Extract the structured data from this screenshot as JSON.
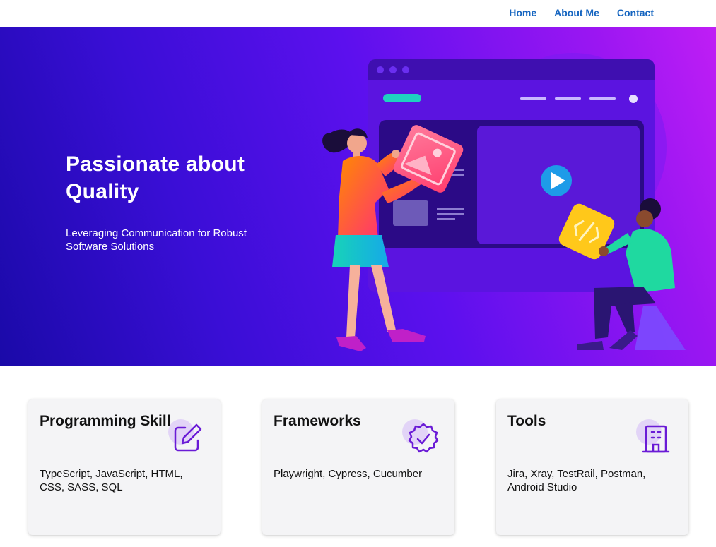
{
  "nav": {
    "links": [
      {
        "label": "Home"
      },
      {
        "label": "About Me"
      },
      {
        "label": "Contact"
      }
    ]
  },
  "hero": {
    "title": "Passionate about Quality",
    "subtitle": "Leveraging Communication for Robust Software Solutions"
  },
  "cards": [
    {
      "title": "Programming Skill",
      "body": "TypeScript, JavaScript, HTML, CSS, SASS, SQL",
      "icon": "edit-icon"
    },
    {
      "title": "Frameworks",
      "body": "Playwright, Cypress, Cucumber",
      "icon": "badge-check-icon"
    },
    {
      "title": "Tools",
      "body": "Jira, Xray, TestRail, Postman, Android Studio",
      "icon": "building-icon"
    }
  ],
  "colors": {
    "nav_link": "#1565c0",
    "hero_gradient_start": "#1a0aa8",
    "hero_gradient_end": "#c01ef5",
    "icon_accent": "#6a1bd6",
    "card_background": "#f4f4f6"
  }
}
